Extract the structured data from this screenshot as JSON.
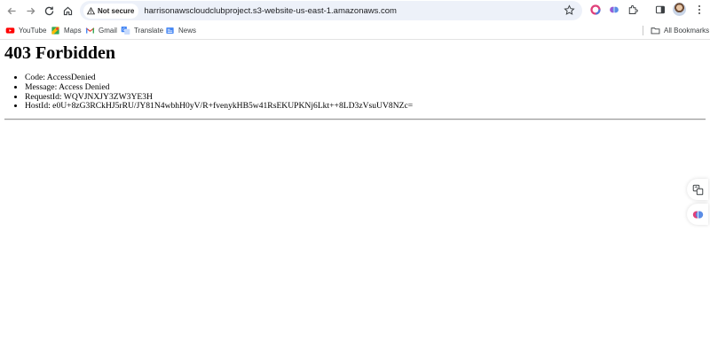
{
  "browser": {
    "security_chip": "Not secure",
    "url": "harrisonawscloudclubproject.s3-website-us-east-1.amazonaws.com",
    "bookmarks": [
      {
        "label": "YouTube",
        "icon": "youtube-icon"
      },
      {
        "label": "Maps",
        "icon": "maps-icon"
      },
      {
        "label": "Gmail",
        "icon": "gmail-icon"
      },
      {
        "label": "Translate",
        "icon": "translate-icon"
      },
      {
        "label": "News",
        "icon": "news-icon"
      }
    ],
    "all_bookmarks": "All Bookmarks",
    "colors": {
      "omnibox": "#edf1f9",
      "youtube": "#ff0000"
    }
  },
  "page": {
    "heading": "403 Forbidden",
    "details": [
      "Code: AccessDenied",
      "Message: Access Denied",
      "RequestId: WQVJNXJY3ZW3YE3H",
      "HostId: e0U+8zG3RCkHJ5rRU/JY81N4wbhH0yV/R+fvenykHB5w41RsEKUPKNj6Lkt++8LD3zVsuUV8NZc="
    ]
  }
}
